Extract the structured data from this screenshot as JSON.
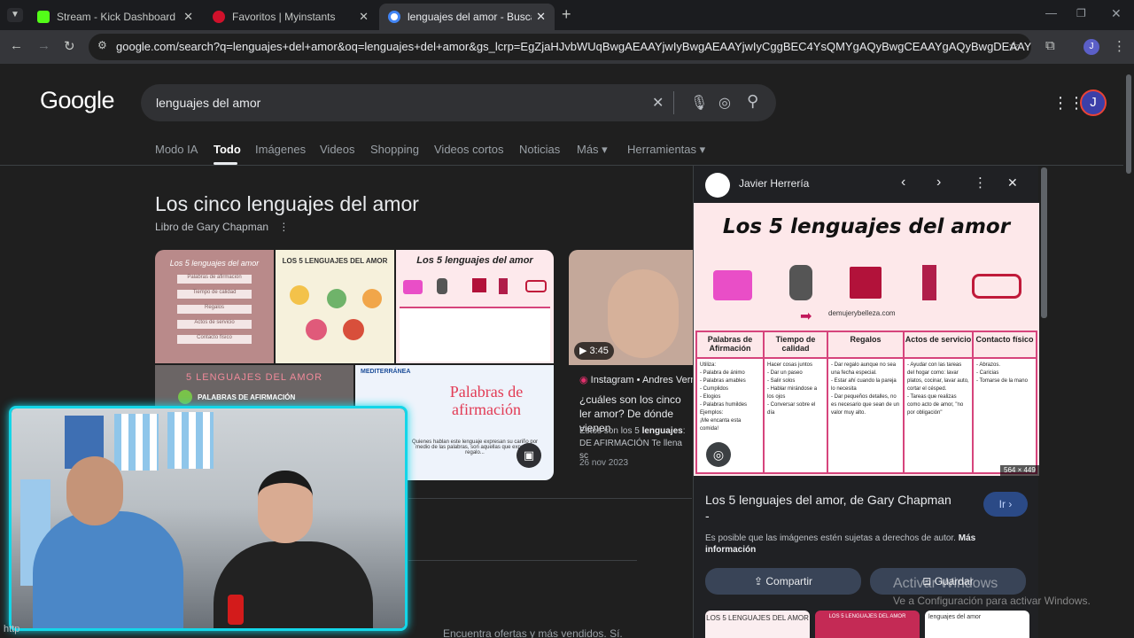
{
  "tabs": [
    {
      "title": "Stream - Kick Dashboard",
      "favicon_color": "#53fc18"
    },
    {
      "title": "Favoritos | Myinstants",
      "favicon_color": "#d0112b"
    },
    {
      "title": "lenguajes del amor - Buscar con",
      "favicon_color": "#4285f4"
    }
  ],
  "url": "google.com/search?q=lenguajes+del+amor&oq=lenguajes+del+amor&gs_lcrp=EgZjaHJvbWUqBwgAEAAYjwIyBwgAEAAYjwIyCggBEC4YsQMYgAQyBwgCEAAYgAQyBwgDEAAYgAQyBwgEEAAY...",
  "profile_initial": "J",
  "google_logo": "Google",
  "search": {
    "query": "lenguajes del amor"
  },
  "nav_tabs": [
    "Modo IA",
    "Todo",
    "Imágenes",
    "Videos",
    "Shopping",
    "Videos cortos",
    "Noticias",
    "Más",
    "Herramientas"
  ],
  "knowledge": {
    "title": "Los cinco lenguajes del amor",
    "subtitle": "Libro de Gary Chapman"
  },
  "thumbs": {
    "t1_title": "Los 5 lenguajes del amor",
    "t1_items": [
      "Palabras de afirmación",
      "Tiempo de calidad",
      "Regalos",
      "Actos de servicio",
      "Contacto físico"
    ],
    "t2_title": "LOS 5 LENGUAJES DEL AMOR",
    "t2_sub": "PALABRAS DE AFIRMACIÓN",
    "t3_title": "Los 5 lenguajes del amor",
    "t4_title": "5 LENGUAJES DEL AMOR",
    "t4_sub": "PALABRAS DE AFIRMACIÓN",
    "t5_brand": "MEDITERRÁNEA",
    "t5_title": "Palabras de afirmación",
    "t5_body": "Quienes hablan este lenguaje expresan su cariño por medio de las palabras, son aquellas que expresan regalo..."
  },
  "video_result": {
    "duration": "3:45",
    "source": "Instagram • Andres Vern",
    "title": "¿cuáles son los cinco ler amor? De dónde vienen",
    "snippet_pre": "Estos son los 5 ",
    "snippet_bold": "lenguajes",
    "snippet_post": ": DE AFIRMACIÓN Te llena sc",
    "date": "26 nov 2023"
  },
  "panel": {
    "source": "Javier Herrería",
    "image_title": "Los 5 lenguajes del amor",
    "image_site": "demujerybelleza.com",
    "dimensions": "564 × 449",
    "columns": [
      {
        "header": "Palabras de Afirmación",
        "body": "Utiliza:\n- Palabra de ánimo\n- Palabras amables\n- Cumplidos\n- Elogios\n- Palabras humildes\nEjemplos:\n¡Me encanta esta comida!"
      },
      {
        "header": "Tiempo de calidad",
        "body": "Hacer cosas juntos\n- Dar un paseo\n- Salir solos\n- Hablar mirándose a los ojos\n- Conversar sobre el día"
      },
      {
        "header": "Regalos",
        "body": "- Dar regalo aunque no sea una fecha especial.\n- Estar ahí cuando la pareja lo necesita\n- Dar pequeños detalles, no es necesario que sean de un valor muy alto."
      },
      {
        "header": "Actos de servicio",
        "body": "- Ayudar con las tareas del hogar como: lavar platos, cocinar, lavar auto, cortar el césped.\n- Tareas que realizas como acto de amor, \"no por obligación\""
      },
      {
        "header": "Contacto físico",
        "body": "- Abrazos.\n- Caricias\n- Tomarse de la mano"
      }
    ],
    "title": "Los 5 lenguajes del amor, de Gary Chapman",
    "title_dash": "-",
    "go_label": "Ir",
    "copyright_text": "Es posible que las imágenes estén sujetas a derechos de autor.",
    "more_info": "Más información",
    "share_label": "Compartir",
    "save_label": "Guardar",
    "related": [
      "LOS 5 LENGUAJES DEL AMOR",
      "LOS 5 LENGUAJES DEL AMOR",
      "lenguajes del amor"
    ]
  },
  "watermark": {
    "line1": "Activar Windows",
    "line2": "Ve a Configuración para activar Windows."
  },
  "bottom_text": "Encuentra ofertas y más vendidos. Sí.",
  "status_url": "http"
}
